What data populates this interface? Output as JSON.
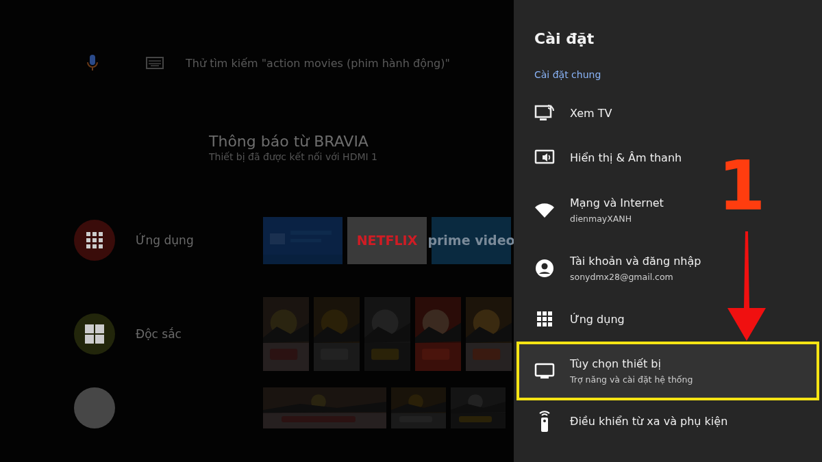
{
  "home": {
    "search": {
      "placeholder": "Thử tìm kiếm \"action movies (phim hành động)\""
    },
    "notification": {
      "title": "Thông báo từ BRAVIA",
      "message": "Thiết bị đã được kết nối với HDMI 1"
    },
    "rows": [
      {
        "label": "Ứng dụng",
        "color": "#3a0c0a",
        "tiles": [
          {
            "kind": "picture"
          },
          {
            "kind": "logo",
            "label": "NETFLIX"
          },
          {
            "kind": "logo",
            "label": "prime video"
          }
        ]
      },
      {
        "label": "Độc sắc",
        "color": "#22260b",
        "tiles": [
          {
            "kind": "picture"
          },
          {
            "kind": "picture"
          },
          {
            "kind": "picture"
          },
          {
            "kind": "picture"
          },
          {
            "kind": "picture"
          }
        ]
      },
      {
        "color": "#474747",
        "tiles": [
          {
            "kind": "picture"
          },
          {
            "kind": "picture"
          },
          {
            "kind": "picture"
          }
        ]
      }
    ]
  },
  "settings": {
    "title": "Cài đặt",
    "section": "Cài đặt chung",
    "items": [
      {
        "label": "Xem TV",
        "selected": false
      },
      {
        "label": "Hiển thị & Âm thanh",
        "selected": false
      },
      {
        "label": "Mạng và Internet",
        "detail": "dienmayXANH",
        "selected": false
      },
      {
        "label": "Tài khoản và đăng nhập",
        "detail": "sonydmx28@gmail.com",
        "selected": false
      },
      {
        "label": "Ứng dụng",
        "selected": false
      },
      {
        "label": "Tùy chọn thiết bị",
        "detail": "Trợ năng và cài đặt hệ thống",
        "selected": true
      },
      {
        "label": "Điều khiển từ xa và phụ kiện",
        "selected": false
      }
    ]
  },
  "annotation": {
    "step": "1"
  }
}
